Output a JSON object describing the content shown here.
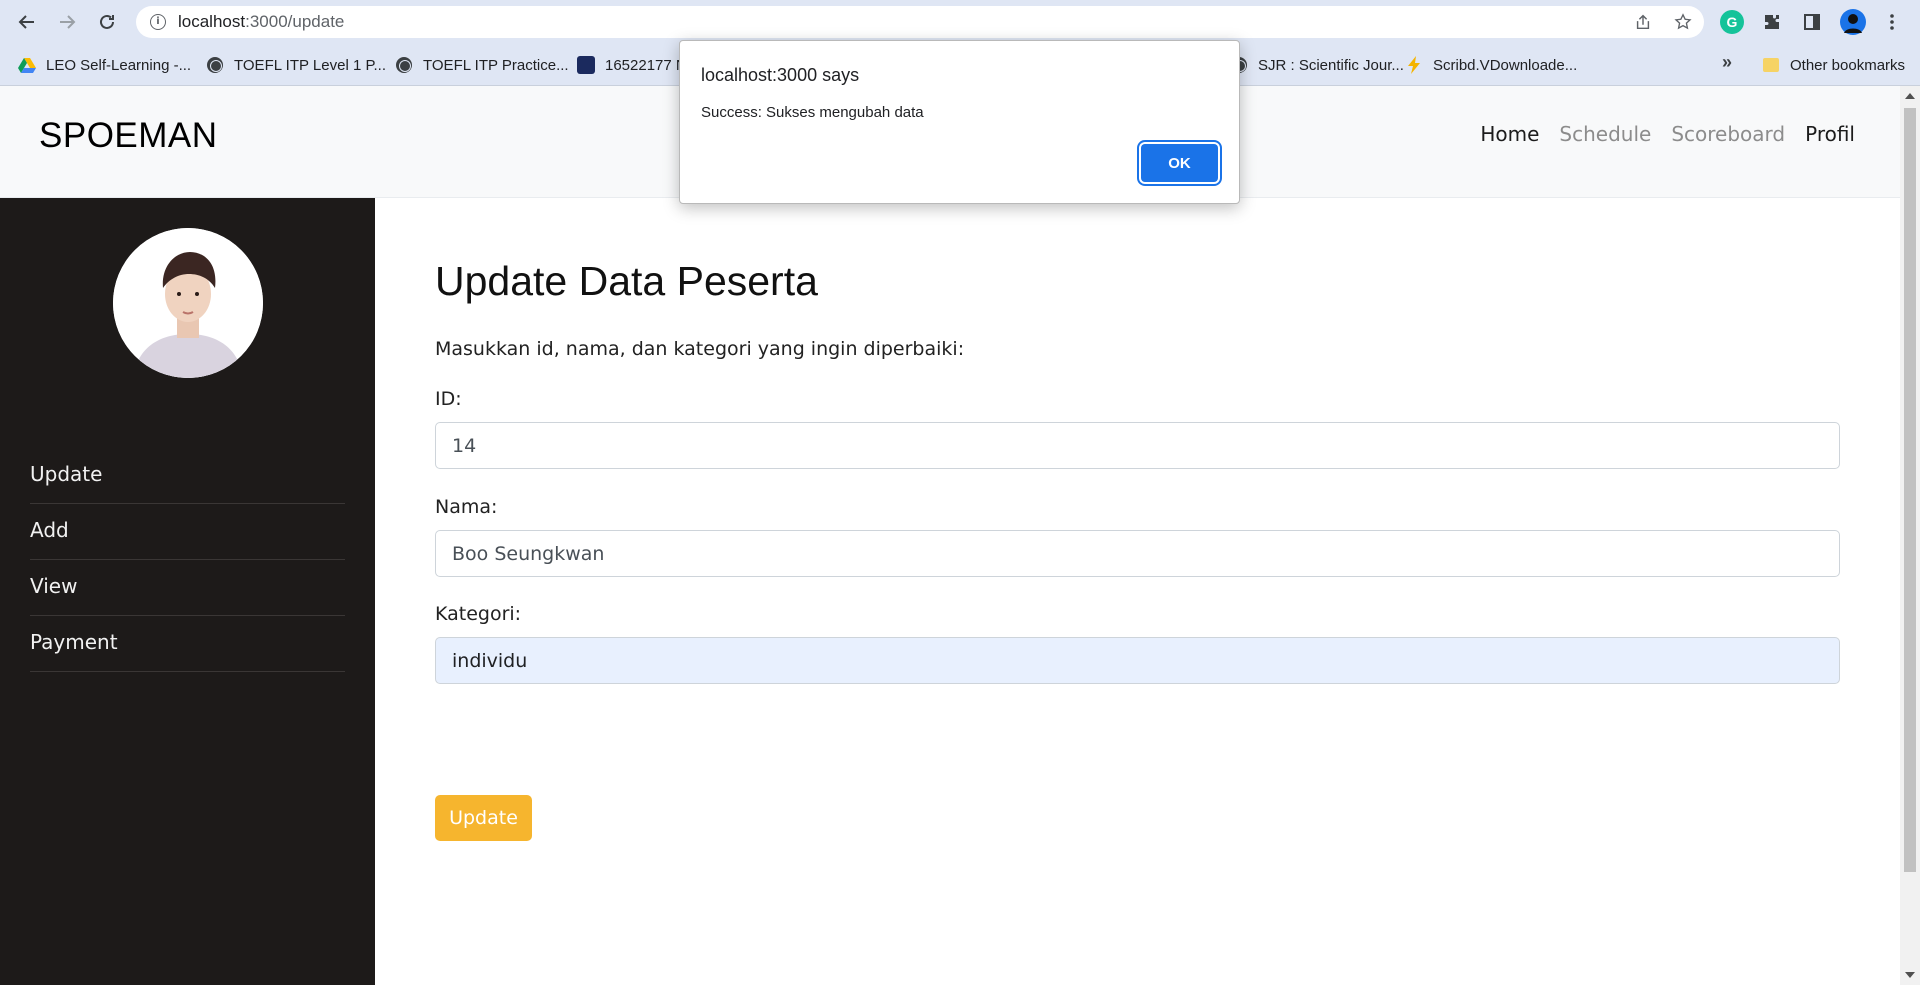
{
  "browser": {
    "url_host": "localhost",
    "url_path": ":3000/update",
    "bookmarks": [
      {
        "label": "LEO Self-Learning -...",
        "icon": "drive-icon"
      },
      {
        "label": "TOEFL ITP Level 1 P...",
        "icon": "globe-icon"
      },
      {
        "label": "TOEFL ITP Practice...",
        "icon": "globe-icon"
      },
      {
        "label": "16522177 N",
        "icon": "grid-icon"
      },
      {
        "label": "SJR : Scientific Jour...",
        "icon": "globe-icon"
      },
      {
        "label": "Scribd.VDownloade...",
        "icon": "lightning-icon"
      }
    ],
    "other_bookmarks": "Other bookmarks",
    "more_bookmarks": "»",
    "grammarly_letter": "G"
  },
  "site": {
    "brand": "SPOEMAN",
    "nav": [
      {
        "label": "Home",
        "state": "active"
      },
      {
        "label": "Schedule",
        "state": "muted"
      },
      {
        "label": "Scoreboard",
        "state": "muted"
      },
      {
        "label": "Profil",
        "state": "active"
      }
    ]
  },
  "sidebar": {
    "items": [
      {
        "label": "Update"
      },
      {
        "label": "Add"
      },
      {
        "label": "View"
      },
      {
        "label": "Payment"
      }
    ]
  },
  "form": {
    "title": "Update Data Peserta",
    "description": "Masukkan id, nama, dan kategori yang ingin diperbaiki:",
    "id_label": "ID:",
    "id_value": "14",
    "nama_label": "Nama:",
    "nama_value": "Boo Seungkwan",
    "kategori_label": "Kategori:",
    "kategori_value": "individu",
    "submit_label": "Update"
  },
  "dialog": {
    "title": "localhost:3000 says",
    "message": "Success: Sukses mengubah data",
    "ok_label": "OK"
  },
  "colors": {
    "sidebar_bg": "#1d1a19",
    "button_yellow": "#f6b52e",
    "dialog_blue": "#1a73e8",
    "autofill_bg": "#e8f0fe"
  }
}
